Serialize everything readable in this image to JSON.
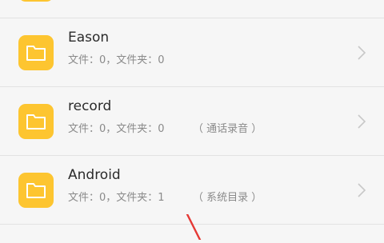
{
  "folders": [
    {
      "name": "",
      "meta": "",
      "tag": ""
    },
    {
      "name": "Eason",
      "meta": "文件：0，文件夹：0",
      "tag": ""
    },
    {
      "name": "record",
      "meta": "文件：0，文件夹：0",
      "tag": "（ 通话录音 ）"
    },
    {
      "name": "Android",
      "meta": "文件：0，文件夹：1",
      "tag": "（ 系统目录 ）"
    }
  ],
  "icons": {
    "folder": "folder-icon",
    "chevron": "chevron-right-icon",
    "pointer": "red-pointer-mark"
  },
  "colors": {
    "folder_accent": "#fdc530",
    "pointer": "#e53935"
  }
}
